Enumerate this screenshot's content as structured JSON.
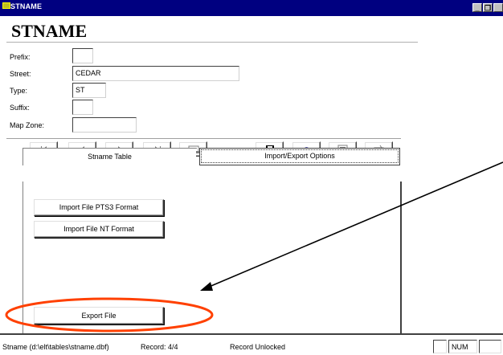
{
  "window": {
    "title": "STNAME",
    "minimize": "_",
    "restore": "&#x2750;",
    "close": ""
  },
  "form": {
    "heading": "STNAME",
    "fields": [
      {
        "label": "Prefix:",
        "value": ""
      },
      {
        "label": "Street:",
        "value": "CEDAR"
      },
      {
        "label": "Type:",
        "value": "ST"
      },
      {
        "label": "Suffix:",
        "value": ""
      },
      {
        "label": "Map Zone:",
        "value": ""
      }
    ]
  },
  "toolbar": {
    "icons": [
      "first-record-icon",
      "previous-record-icon",
      "next-record-icon",
      "last-record-icon",
      "find-icon",
      "save-icon",
      "undo-icon",
      "delete-icon",
      "new-record-icon"
    ]
  },
  "tabs": [
    {
      "label": "Stname Table",
      "active": true
    },
    {
      "label": "Import/Export Options",
      "active": false
    }
  ],
  "buttons": {
    "import_pts3": "Import File PTS3 Format",
    "import_nt": "Import File NT Format",
    "export": "Export File"
  },
  "status": {
    "file": "Stname (d:\\elt\\tables\\stname.dbf)",
    "record": "Record: 4/4",
    "lock": "Record Unlocked",
    "num": "NUM"
  },
  "colors": {
    "titlebar": "#000080",
    "annotation": "#ff4000"
  }
}
